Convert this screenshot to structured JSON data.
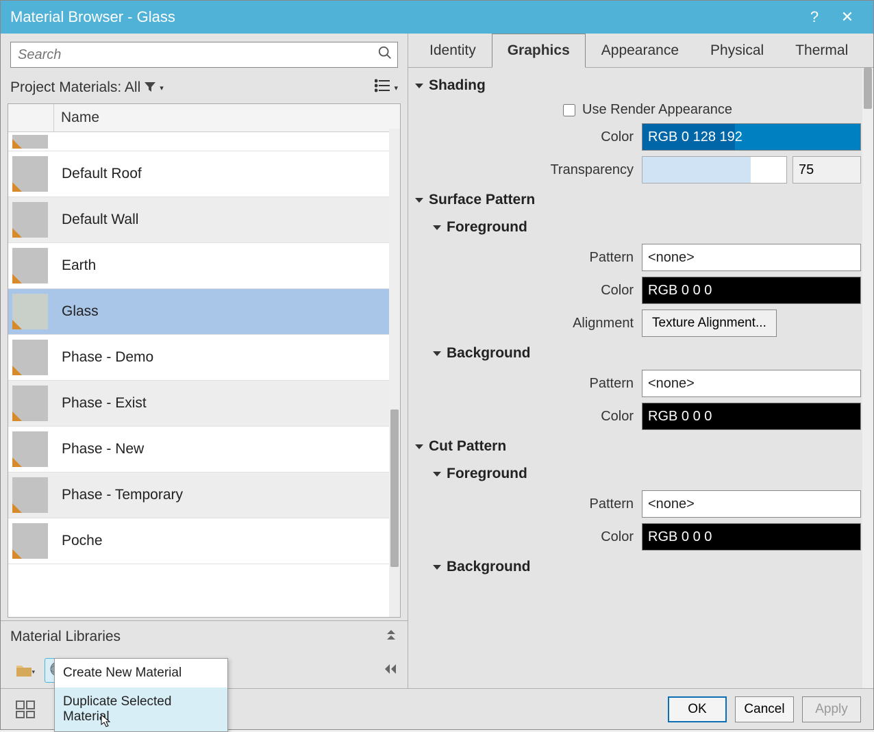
{
  "title": "Material Browser - Glass",
  "search_placeholder": "Search",
  "project_materials_label": "Project Materials: All",
  "material_header_name": "Name",
  "materials": [
    {
      "name": ""
    },
    {
      "name": "Default Roof"
    },
    {
      "name": "Default Wall"
    },
    {
      "name": "Earth"
    },
    {
      "name": "Glass"
    },
    {
      "name": "Phase - Demo"
    },
    {
      "name": "Phase - Exist"
    },
    {
      "name": "Phase - New"
    },
    {
      "name": "Phase - Temporary"
    },
    {
      "name": "Poche"
    }
  ],
  "material_libraries_label": "Material Libraries",
  "context_menu": {
    "create": "Create New Material",
    "duplicate": "Duplicate Selected Material"
  },
  "tabs": {
    "identity": "Identity",
    "graphics": "Graphics",
    "appearance": "Appearance",
    "physical": "Physical",
    "thermal": "Thermal"
  },
  "sections": {
    "shading": "Shading",
    "surface_pattern": "Surface Pattern",
    "foreground": "Foreground",
    "background": "Background",
    "cut_pattern": "Cut Pattern"
  },
  "labels": {
    "use_render": "Use Render Appearance",
    "color": "Color",
    "transparency": "Transparency",
    "pattern": "Pattern",
    "alignment": "Alignment"
  },
  "values": {
    "shading_color": "RGB 0 128 192",
    "transparency": "75",
    "pattern_none": "<none>",
    "color_black": "RGB 0 0 0",
    "alignment_btn": "Texture Alignment..."
  },
  "buttons": {
    "ok": "OK",
    "cancel": "Cancel",
    "apply": "Apply"
  }
}
